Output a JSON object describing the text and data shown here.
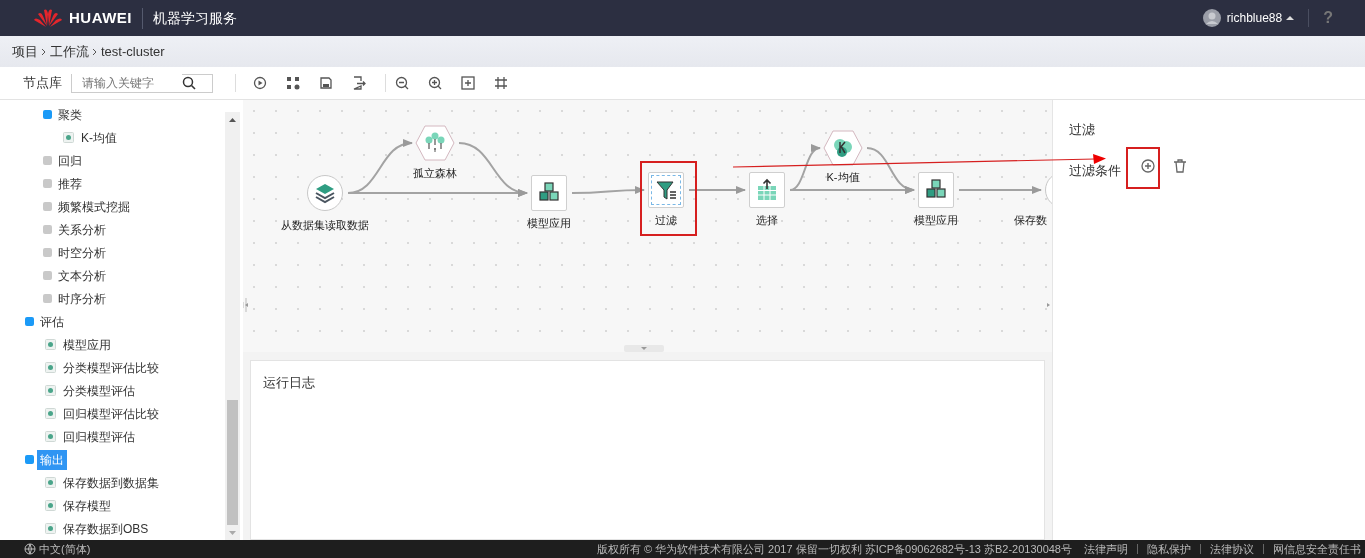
{
  "header": {
    "brand": "HUAWEI",
    "service": "机器学习服务",
    "user": "richblue88",
    "help": "?"
  },
  "breadcrumb": [
    "项目",
    "工作流",
    "test-cluster"
  ],
  "toolbar": {
    "label": "节点库",
    "search": {
      "placeholder": "请输入关键字"
    }
  },
  "tree": [
    {
      "children": [
        {
          "label": "聚类",
          "kind": "group",
          "expanded": true,
          "selected": false,
          "children": [
            {
              "label": "K-均值",
              "kind": "leaf",
              "selected": false
            }
          ]
        },
        {
          "label": "回归",
          "kind": "group",
          "expanded": false,
          "selected": false
        },
        {
          "label": "推荐",
          "kind": "group",
          "expanded": false,
          "selected": false
        },
        {
          "label": "频繁模式挖掘",
          "kind": "group",
          "expanded": false,
          "selected": false
        },
        {
          "label": "关系分析",
          "kind": "group",
          "expanded": false,
          "selected": false
        },
        {
          "label": "时空分析",
          "kind": "group",
          "expanded": false,
          "selected": false
        },
        {
          "label": "文本分析",
          "kind": "group",
          "expanded": false,
          "selected": false
        },
        {
          "label": "时序分析",
          "kind": "group",
          "expanded": false,
          "selected": false
        }
      ]
    },
    {
      "label": "评估",
      "kind": "group",
      "expanded": true,
      "selected": false,
      "children": [
        {
          "label": "模型应用",
          "kind": "leaf",
          "selected": false
        },
        {
          "label": "分类模型评估比较",
          "kind": "leaf",
          "selected": false
        },
        {
          "label": "分类模型评估",
          "kind": "leaf",
          "selected": false
        },
        {
          "label": "回归模型评估比较",
          "kind": "leaf",
          "selected": false
        },
        {
          "label": "回归模型评估",
          "kind": "leaf",
          "selected": false
        }
      ]
    },
    {
      "label": "输出",
      "kind": "group",
      "expanded": true,
      "selected": true,
      "children": [
        {
          "label": "保存数据到数据集",
          "kind": "leaf",
          "selected": false
        },
        {
          "label": "保存模型",
          "kind": "leaf",
          "selected": false
        },
        {
          "label": "保存数据到OBS",
          "kind": "leaf",
          "selected": false
        }
      ]
    }
  ],
  "canvas": {
    "nodes": [
      {
        "label": "从数据集读取数据",
        "kind": "dataset",
        "selected": false,
        "highlighted": false
      },
      {
        "label": "孤立森林",
        "kind": "forest",
        "selected": false,
        "highlighted": false
      },
      {
        "label": "模型应用",
        "kind": "apply",
        "selected": false,
        "highlighted": false
      },
      {
        "label": "过滤",
        "kind": "filter",
        "selected": true,
        "highlighted": true
      },
      {
        "label": "选择",
        "kind": "select",
        "selected": false,
        "highlighted": false
      },
      {
        "label": "K-均值",
        "kind": "kmeans",
        "selected": false,
        "highlighted": false
      },
      {
        "label": "模型应用",
        "kind": "apply",
        "selected": false,
        "highlighted": false
      },
      {
        "label": "保存数",
        "kind": "save",
        "selected": false,
        "highlighted": false
      }
    ]
  },
  "log": {
    "title": "运行日志"
  },
  "panel": {
    "title": "过滤",
    "field_label": "过滤条件",
    "add_highlighted": true
  },
  "footer": {
    "language": "中文(简体)",
    "copyright": "版权所有 © 华为软件技术有限公司 2017  保留一切权利  苏ICP备09062682号-13  苏B2-20130048号",
    "links": [
      "法律声明",
      "隐私保护",
      "法律协议",
      "网信息安全责任书"
    ]
  }
}
